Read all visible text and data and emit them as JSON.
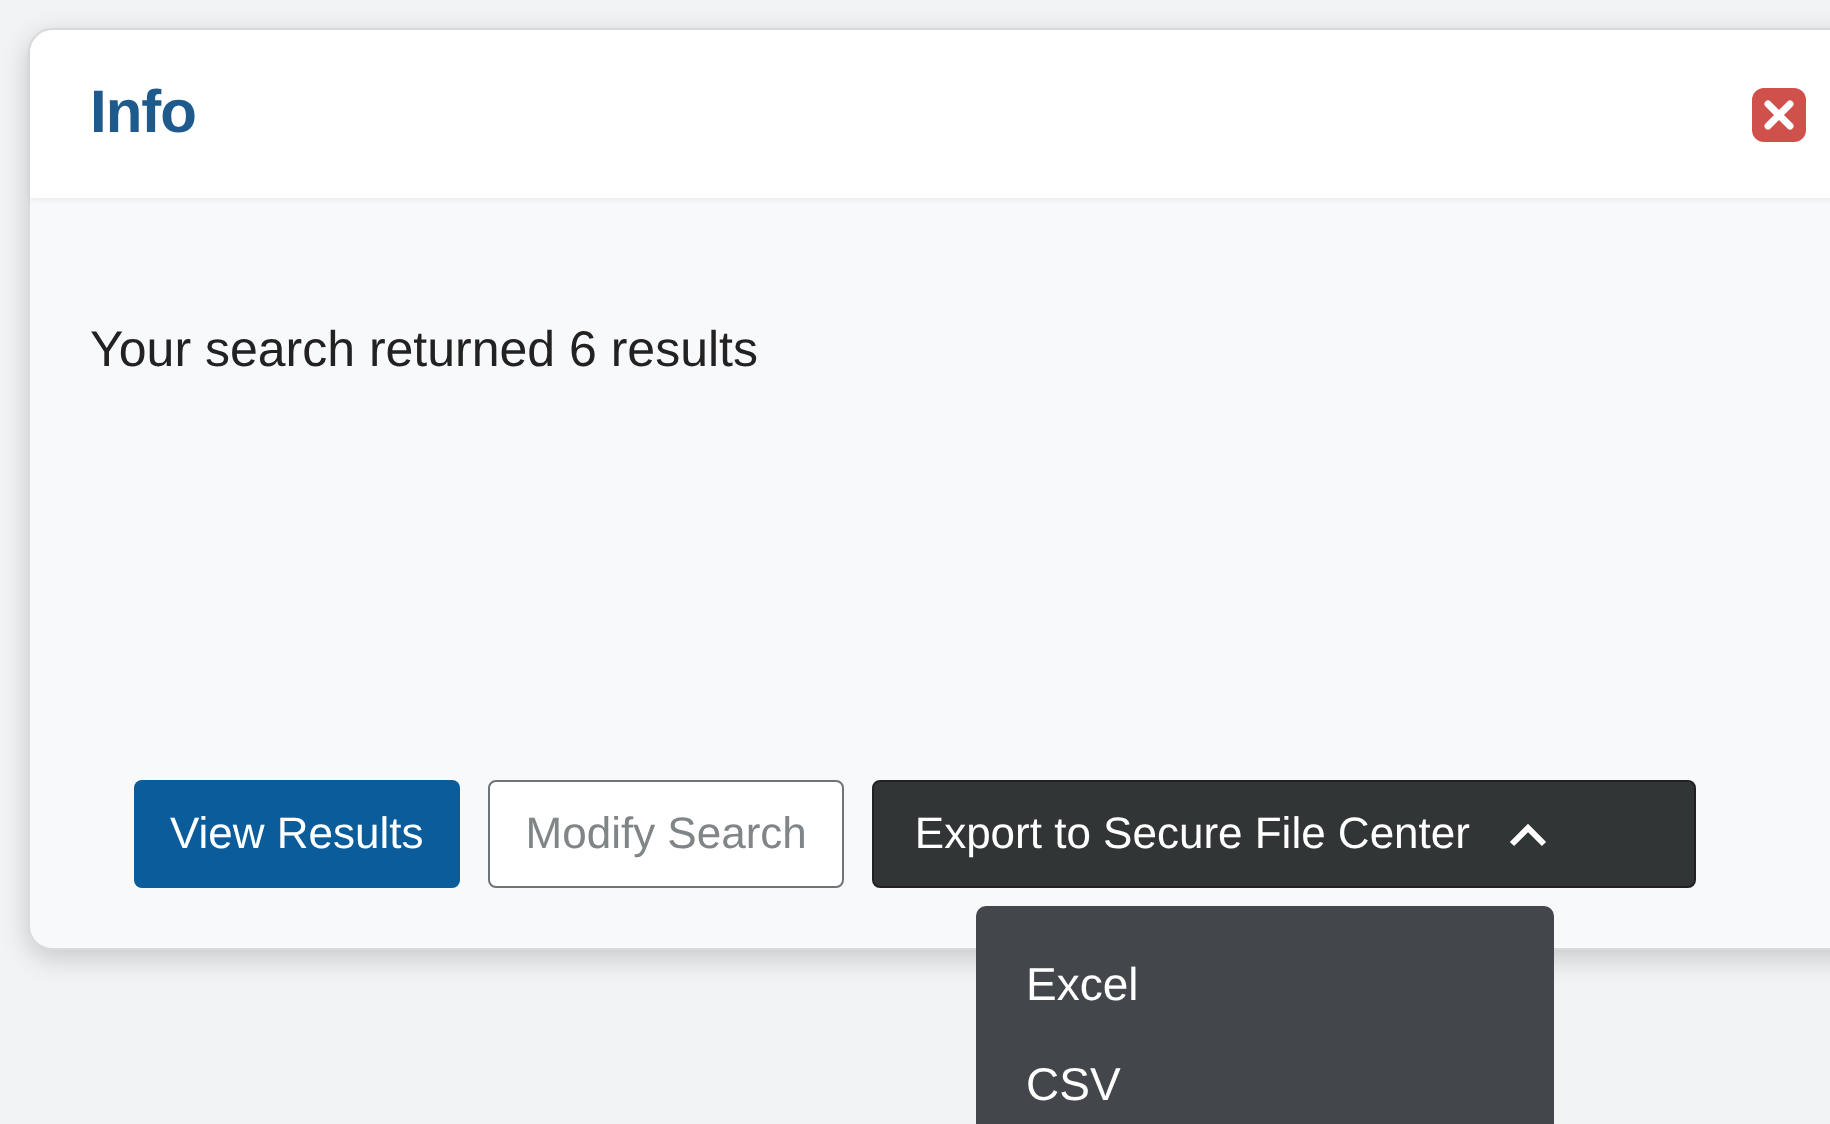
{
  "dialog": {
    "title": "Info",
    "message": "Your search returned 6 results"
  },
  "buttons": [
    {
      "label": "View Results",
      "kind": "primary"
    },
    {
      "label": "Modify Search",
      "kind": "secondary"
    },
    {
      "label": "Export to Secure File Center",
      "kind": "dropdown",
      "expanded": true
    }
  ],
  "export_menu": {
    "items": [
      "Excel",
      "CSV"
    ]
  }
}
